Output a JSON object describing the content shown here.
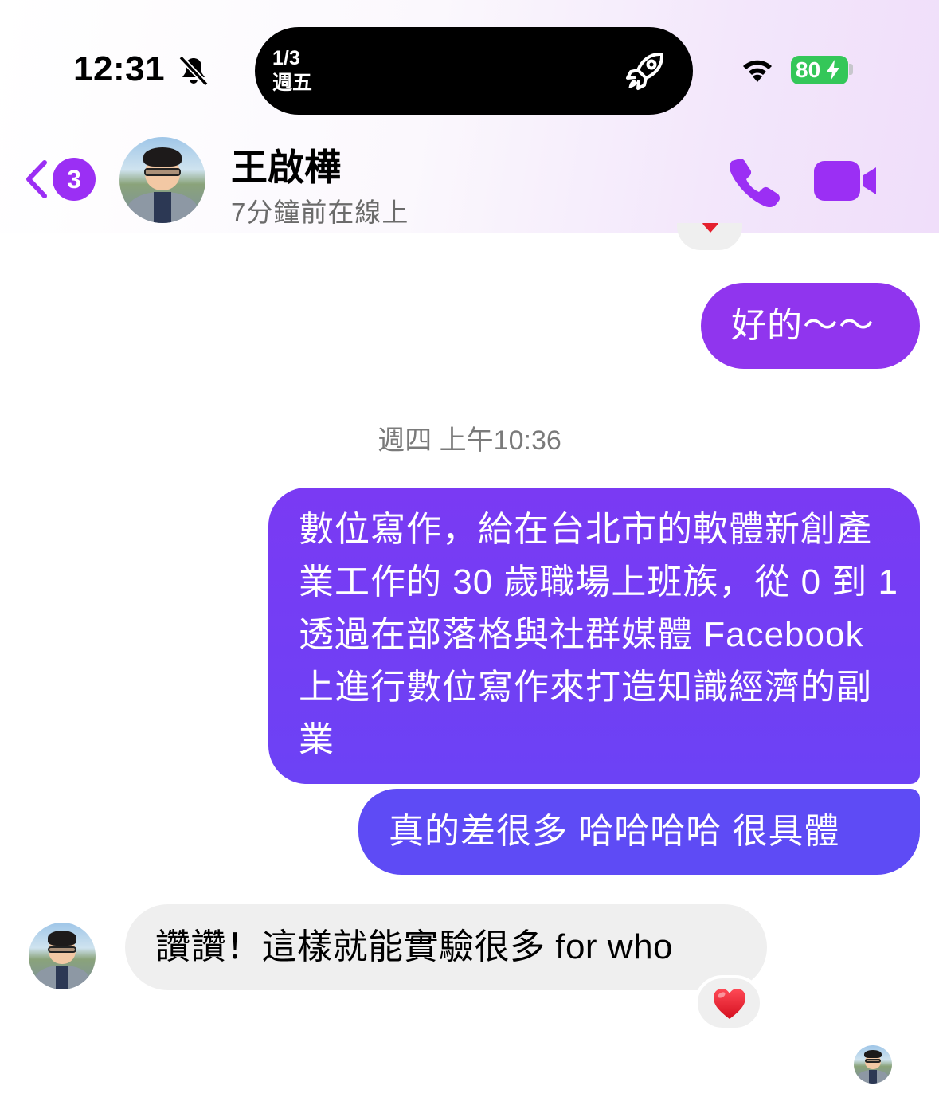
{
  "status_bar": {
    "time": "12:31",
    "island_date_line1": "1/3",
    "island_date_line2": "週五",
    "battery": "80"
  },
  "header": {
    "back_badge": "3",
    "contact_name": "王啟樺",
    "contact_status": "7分鐘前在線上"
  },
  "messages": {
    "sent_1": "好的～～",
    "timestamp": "週四 上午10:36",
    "sent_2": "數位寫作，給在台北市的軟體新創產業工作的 30 歲職場上班族，從 0 到 1 透過在部落格與社群媒體 Facebook 上進行數位寫作來打造知識經濟的副業",
    "sent_3": "真的差很多 哈哈哈哈 很具體",
    "received_1": "讚讚！這樣就能實驗很多 for who"
  },
  "colors": {
    "accent": "#9b2ff4",
    "bubble_sent_top": "#9035ee",
    "bubble_sent_mid": "#7a3af3",
    "bubble_sent_bottom": "#5e4bf5",
    "bubble_received": "#efefef",
    "battery_green": "#34c759"
  },
  "icons": [
    "bell-slash-icon",
    "rocket-icon",
    "wifi-icon",
    "battery-icon",
    "chevron-left-icon",
    "phone-icon",
    "video-camera-icon",
    "heart-icon"
  ]
}
